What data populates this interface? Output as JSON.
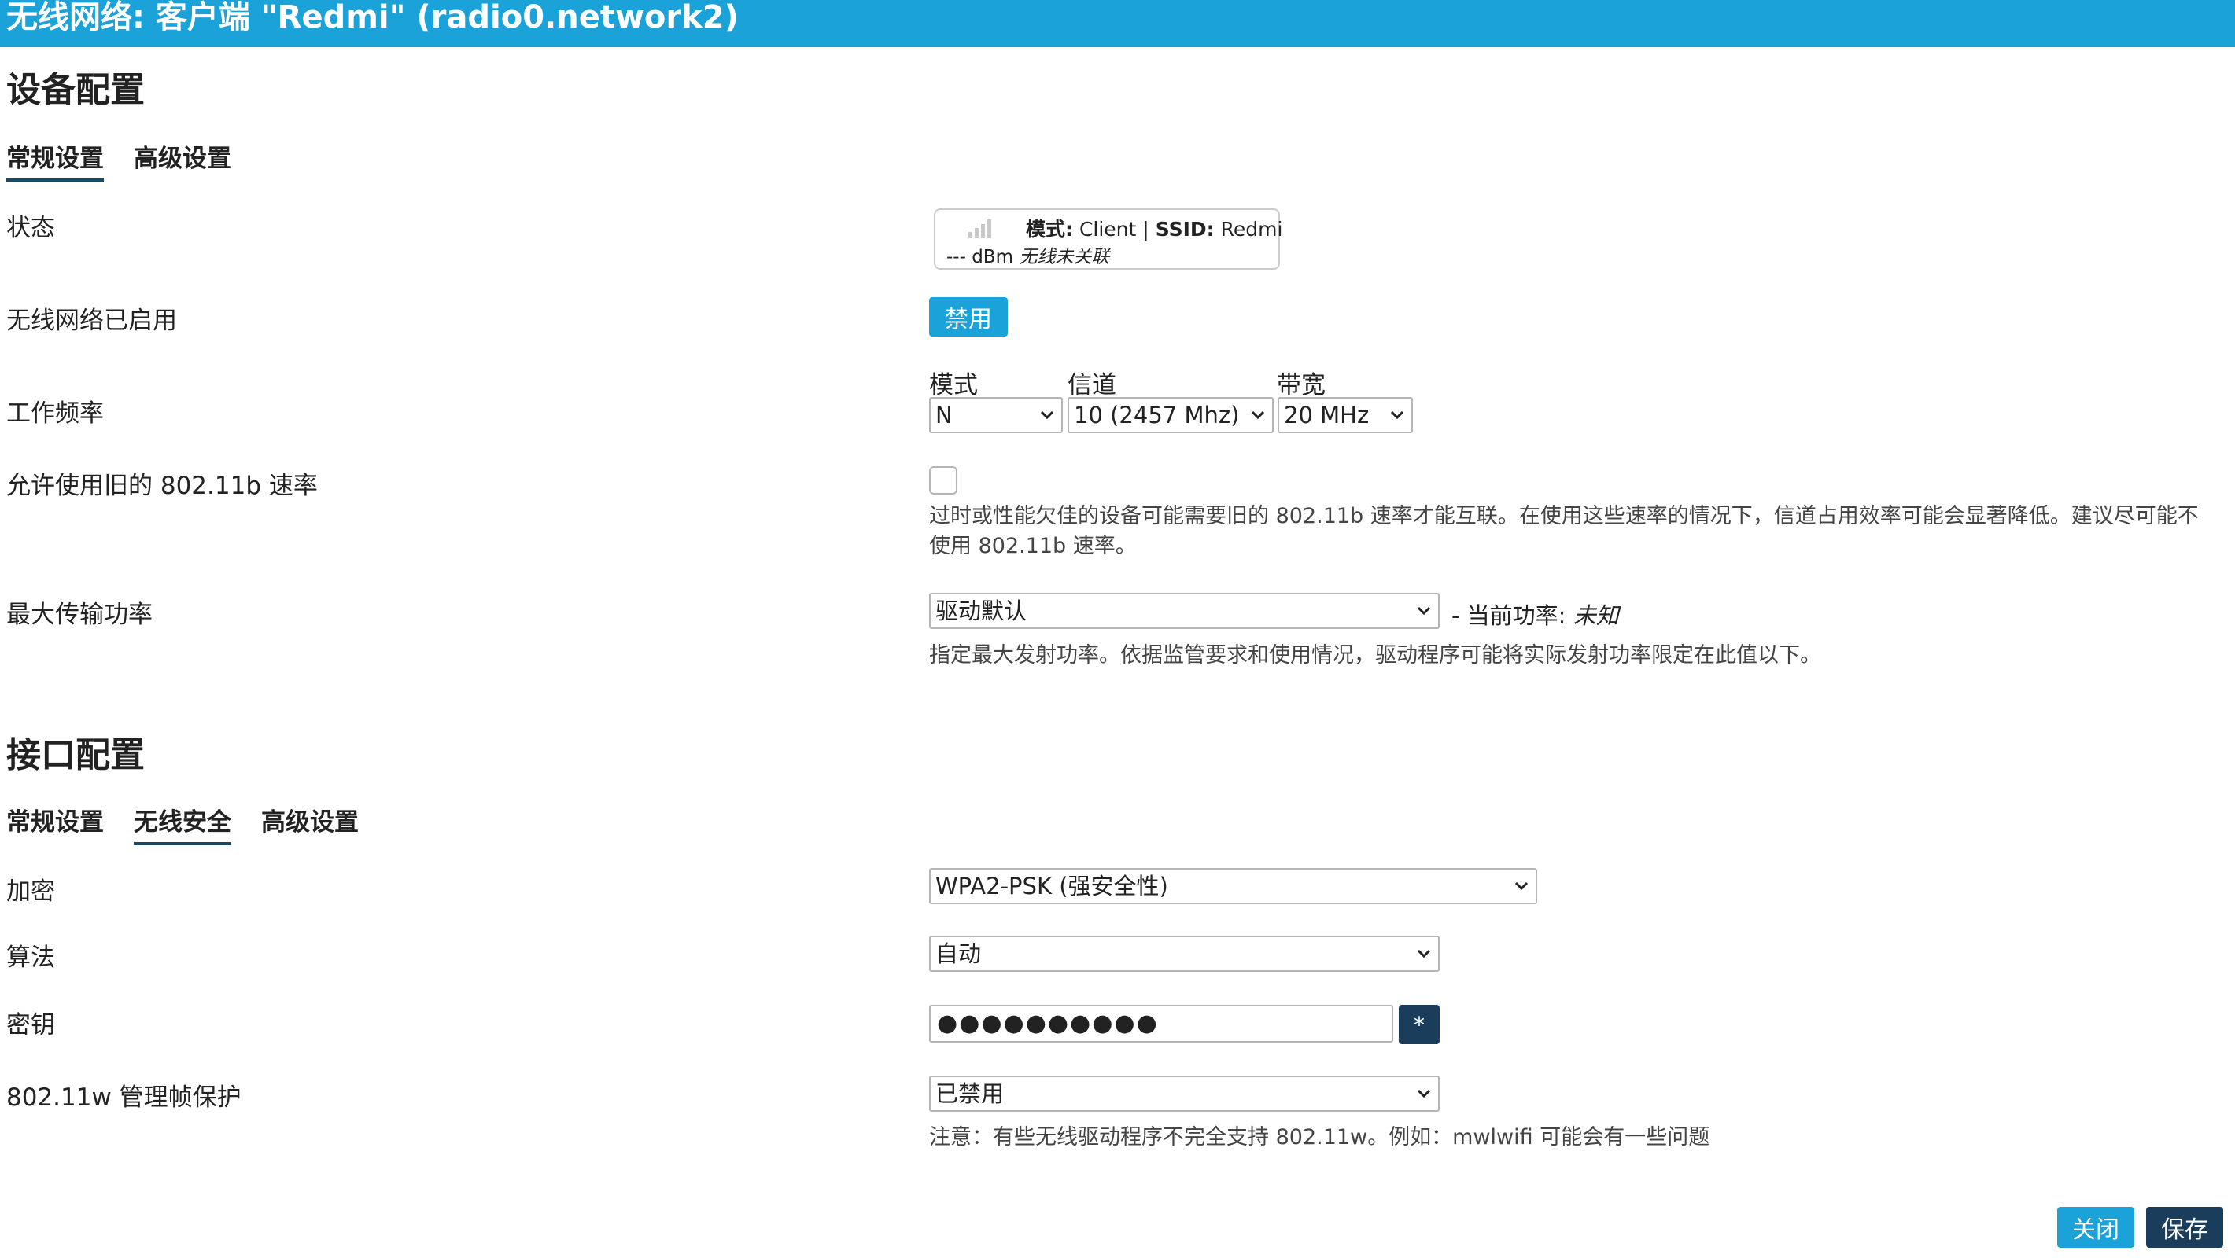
{
  "window": {
    "title": "无线网络: 客户端 \"Redmi\" (radio0.network2)"
  },
  "device_config": {
    "heading": "设备配置",
    "tabs": [
      {
        "label": "常规设置",
        "active": true
      },
      {
        "label": "高级设置",
        "active": false
      }
    ],
    "status": {
      "label": "状态",
      "mode_label": "模式:",
      "mode_value": "Client",
      "separator": "|",
      "ssid_label": "SSID:",
      "ssid_value": "Redmi",
      "signal_text": "--- dBm",
      "assoc_text": "无线未关联"
    },
    "enabled": {
      "label": "无线网络已启用",
      "button_label": "禁用"
    },
    "frequency": {
      "label": "工作频率",
      "mode_header": "模式",
      "channel_header": "信道",
      "width_header": "带宽",
      "mode_value": "N",
      "channel_value": "10 (2457 Mhz)",
      "width_value": "20 MHz"
    },
    "legacy_rates": {
      "label": "允许使用旧的 802.11b 速率",
      "checked": false,
      "description": "过时或性能欠佳的设备可能需要旧的 802.11b 速率才能互联。在使用这些速率的情况下，信道占用效率可能会显著降低。建议尽可能不使用 802.11b 速率。"
    },
    "tx_power": {
      "label": "最大传输功率",
      "value": "驱动默认",
      "current_prefix": "- 当前功率:",
      "current_value": "未知",
      "description": "指定最大发射功率。依据监管要求和使用情况，驱动程序可能将实际发射功率限定在此值以下。"
    }
  },
  "interface_config": {
    "heading": "接口配置",
    "tabs": [
      {
        "label": "常规设置",
        "active": false
      },
      {
        "label": "无线安全",
        "active": true
      },
      {
        "label": "高级设置",
        "active": false
      }
    ],
    "encryption": {
      "label": "加密",
      "value": "WPA2-PSK (强安全性)"
    },
    "cipher": {
      "label": "算法",
      "value": "自动"
    },
    "key": {
      "label": "密钥",
      "value": "●●●●●●●●●●",
      "reveal_label": "*"
    },
    "mfp": {
      "label": "802.11w 管理帧保护",
      "value": "已禁用",
      "note": "注意：有些无线驱动程序不完全支持 802.11w。例如：mwlwifi 可能会有一些问题"
    }
  },
  "footer": {
    "close_label": "关闭",
    "save_label": "保存"
  },
  "colors": {
    "accent": "#1ba2d8",
    "dark_button": "#1a3d5c",
    "tab_underline": "#1a4a63"
  },
  "icons": {
    "signal": "signal-bars-icon",
    "select_arrow": "chevron-down-icon"
  }
}
